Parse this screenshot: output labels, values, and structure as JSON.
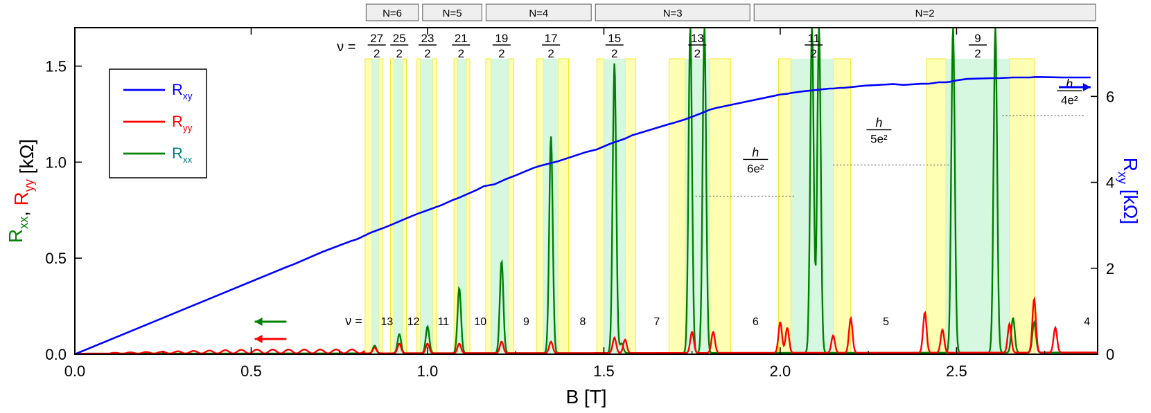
{
  "chart_data": {
    "type": "line",
    "xlabel": "B [T]",
    "ylabel_left": {
      "parts": [
        {
          "t": "R",
          "sub": "xx",
          "color": "#008000"
        },
        {
          "t": ", ",
          "sub": "",
          "color": "#000000"
        },
        {
          "t": "R",
          "sub": "yy",
          "color": "#ff0000"
        },
        {
          "t": " [kΩ]",
          "sub": "",
          "color": "#000000"
        }
      ]
    },
    "ylabel_right": {
      "t": "R",
      "sub": "xy",
      "unit": " [kΩ]",
      "color": "#0000ff"
    },
    "xlim": [
      0,
      2.9
    ],
    "ylim_left": [
      0,
      1.7
    ],
    "ylim_right": [
      0,
      7.6
    ],
    "x_ticks": [
      "0.0",
      "0.5",
      "1.0",
      "1.5",
      "2.0",
      "2.5"
    ],
    "y_left_ticks": [
      "0.0",
      "0.5",
      "1.0",
      "1.5"
    ],
    "y_right_ticks": [
      "0",
      "2",
      "4",
      "6"
    ],
    "legend": {
      "position": "top-left",
      "entries": [
        {
          "name": "R",
          "sub": "xy",
          "color": "#0000ff"
        },
        {
          "name": "R",
          "sub": "yy",
          "color": "#ff0000"
        },
        {
          "name": "R",
          "sub": "xx",
          "color": "#008080",
          "line": "#008000"
        }
      ]
    },
    "landau_levels": [
      {
        "label": "N=6",
        "x0": 0.82,
        "x1": 0.98
      },
      {
        "label": "N=5",
        "x0": 0.98,
        "x1": 1.16
      },
      {
        "label": "N=4",
        "x0": 1.16,
        "x1": 1.47
      },
      {
        "label": "N=3",
        "x0": 1.47,
        "x1": 1.92
      },
      {
        "label": "N=2",
        "x0": 1.92,
        "x1": 2.9
      }
    ],
    "nu_top_prefix": "ν =",
    "half_filling": [
      {
        "num": "27",
        "den": "2",
        "x": 0.856
      },
      {
        "num": "25",
        "den": "2",
        "x": 0.92
      },
      {
        "num": "23",
        "den": "2",
        "x": 1.0
      },
      {
        "num": "21",
        "den": "2",
        "x": 1.095
      },
      {
        "num": "19",
        "den": "2",
        "x": 1.21
      },
      {
        "num": "17",
        "den": "2",
        "x": 1.35
      },
      {
        "num": "15",
        "den": "2",
        "x": 1.53
      },
      {
        "num": "13",
        "den": "2",
        "x": 1.765
      },
      {
        "num": "11",
        "den": "2",
        "x": 2.095
      },
      {
        "num": "9",
        "den": "2",
        "x": 2.56
      }
    ],
    "integer_filling_prefix": "ν =",
    "integer_filling": [
      {
        "v": "13",
        "x": 0.885
      },
      {
        "v": "12",
        "x": 0.96
      },
      {
        "v": "11",
        "x": 1.045
      },
      {
        "v": "10",
        "x": 1.15
      },
      {
        "v": "9",
        "x": 1.28
      },
      {
        "v": "8",
        "x": 1.44
      },
      {
        "v": "7",
        "x": 1.65
      },
      {
        "v": "6",
        "x": 1.93
      },
      {
        "v": "5",
        "x": 2.3
      },
      {
        "v": "4",
        "x": 2.87
      }
    ],
    "hall_plateaus": [
      {
        "num": "h",
        "den": "6e²",
        "y_right": 4.26,
        "x0": 1.76,
        "x1": 2.04,
        "label_x": 1.93,
        "label_y_right": 5.25
      },
      {
        "num": "h",
        "den": "5e²",
        "y_right": 5.1,
        "x0": 2.15,
        "x1": 2.48,
        "label_x": 2.28,
        "label_y_right": 6.05
      },
      {
        "num": "h",
        "den": "4e²",
        "y_right": 6.43,
        "x0": 2.63,
        "x1": 2.86,
        "label_x": 2.82,
        "label_y_right": 7.1
      }
    ],
    "shaded_bands": {
      "yellow": [
        [
          0.823,
          0.843
        ],
        [
          0.862,
          0.872
        ],
        [
          0.895,
          0.905
        ],
        [
          0.93,
          0.94
        ],
        [
          0.97,
          0.98
        ],
        [
          1.015,
          1.025
        ],
        [
          1.075,
          1.085
        ],
        [
          1.11,
          1.12
        ],
        [
          1.165,
          1.18
        ],
        [
          1.23,
          1.245
        ],
        [
          1.31,
          1.33
        ],
        [
          1.37,
          1.4
        ],
        [
          1.48,
          1.5
        ],
        [
          1.56,
          1.59
        ],
        [
          1.685,
          1.73
        ],
        [
          1.8,
          1.86
        ],
        [
          1.995,
          2.03
        ],
        [
          2.15,
          2.2
        ],
        [
          2.415,
          2.47
        ],
        [
          2.65,
          2.72
        ]
      ],
      "cyan": [
        [
          0.843,
          0.862
        ],
        [
          0.905,
          0.93
        ],
        [
          0.98,
          1.015
        ],
        [
          1.085,
          1.11
        ],
        [
          1.18,
          1.23
        ],
        [
          1.33,
          1.37
        ],
        [
          1.5,
          1.56
        ],
        [
          1.73,
          1.8
        ],
        [
          2.03,
          2.15
        ],
        [
          2.47,
          2.65
        ]
      ]
    },
    "series": [
      {
        "name": "R",
        "sub": "xy",
        "color": "#0000ff",
        "axis": "right",
        "x": [
          0.0,
          0.6,
          0.62,
          0.7,
          0.78,
          0.8,
          0.84,
          0.88,
          0.9,
          0.94,
          0.97,
          1.0,
          1.04,
          1.07,
          1.09,
          1.14,
          1.16,
          1.19,
          1.22,
          1.25,
          1.3,
          1.32,
          1.37,
          1.45,
          1.48,
          1.5,
          1.52,
          1.56,
          1.58,
          1.68,
          1.7,
          1.73,
          1.75,
          1.78,
          1.8,
          1.82,
          1.98,
          2.0,
          2.02,
          2.03,
          2.06,
          2.12,
          2.14,
          2.15,
          2.17,
          2.18,
          2.2,
          2.24,
          2.32,
          2.35,
          2.37,
          2.4,
          2.42,
          2.45,
          2.47,
          2.48,
          2.5,
          2.53,
          2.56,
          2.6,
          2.62,
          2.64,
          2.66,
          2.71,
          2.72,
          2.74,
          2.8,
          2.88
        ],
        "y": [
          0.0,
          2.35,
          2.42,
          2.75,
          3.04,
          3.1,
          3.28,
          3.42,
          3.5,
          3.66,
          3.78,
          3.88,
          4.02,
          4.15,
          4.22,
          4.43,
          4.53,
          4.58,
          4.71,
          4.82,
          5.02,
          5.08,
          5.2,
          5.45,
          5.52,
          5.6,
          5.68,
          5.81,
          5.9,
          6.19,
          6.24,
          6.33,
          6.4,
          6.51,
          6.59,
          6.64,
          6.96,
          7.0,
          7.02,
          7.04,
          7.08,
          7.14,
          7.16,
          7.16,
          7.18,
          7.18,
          7.2,
          7.24,
          7.28,
          7.26,
          7.27,
          7.29,
          7.29,
          7.33,
          7.33,
          7.34,
          7.38,
          7.42,
          7.43,
          7.44,
          7.44,
          7.45,
          7.46,
          7.46,
          7.47,
          7.47,
          7.46,
          7.46
        ],
        "dashed_until": 0.5
      },
      {
        "name": "R",
        "sub": "yy",
        "color": "#ff0000",
        "axis": "left",
        "peaks": [
          [
            0.85,
            0.03
          ],
          [
            0.92,
            0.05
          ],
          [
            1.0,
            0.05
          ],
          [
            1.09,
            0.05
          ],
          [
            1.21,
            0.06
          ],
          [
            1.35,
            0.06
          ],
          [
            1.53,
            0.08
          ],
          [
            1.56,
            0.07
          ],
          [
            1.75,
            0.11
          ],
          [
            1.81,
            0.11
          ],
          [
            2.0,
            0.16
          ],
          [
            2.02,
            0.13
          ],
          [
            2.15,
            0.09
          ],
          [
            2.2,
            0.18
          ],
          [
            2.41,
            0.21
          ],
          [
            2.46,
            0.12
          ],
          [
            2.65,
            0.15
          ],
          [
            2.72,
            0.28
          ],
          [
            2.78,
            0.13
          ]
        ]
      },
      {
        "name": "R",
        "sub": "xx",
        "color": "#008000",
        "axis": "left",
        "peaks": [
          [
            0.85,
            0.04
          ],
          [
            0.92,
            0.1
          ],
          [
            1.0,
            0.14
          ],
          [
            1.09,
            0.34
          ],
          [
            1.21,
            0.48
          ],
          [
            1.35,
            1.13
          ],
          [
            1.53,
            1.51
          ],
          [
            1.55,
            0.05
          ],
          [
            1.745,
            1.7
          ],
          [
            1.785,
            1.7
          ],
          [
            2.09,
            1.7
          ],
          [
            2.11,
            1.7
          ],
          [
            2.49,
            1.7
          ],
          [
            2.61,
            1.7
          ],
          [
            2.66,
            0.18
          ],
          [
            2.72,
            0.16
          ]
        ]
      }
    ],
    "arrows": [
      {
        "direction": "left",
        "color": "#008000"
      },
      {
        "direction": "left",
        "color": "#ff0000"
      },
      {
        "direction": "right",
        "color": "#0000ff"
      }
    ]
  }
}
